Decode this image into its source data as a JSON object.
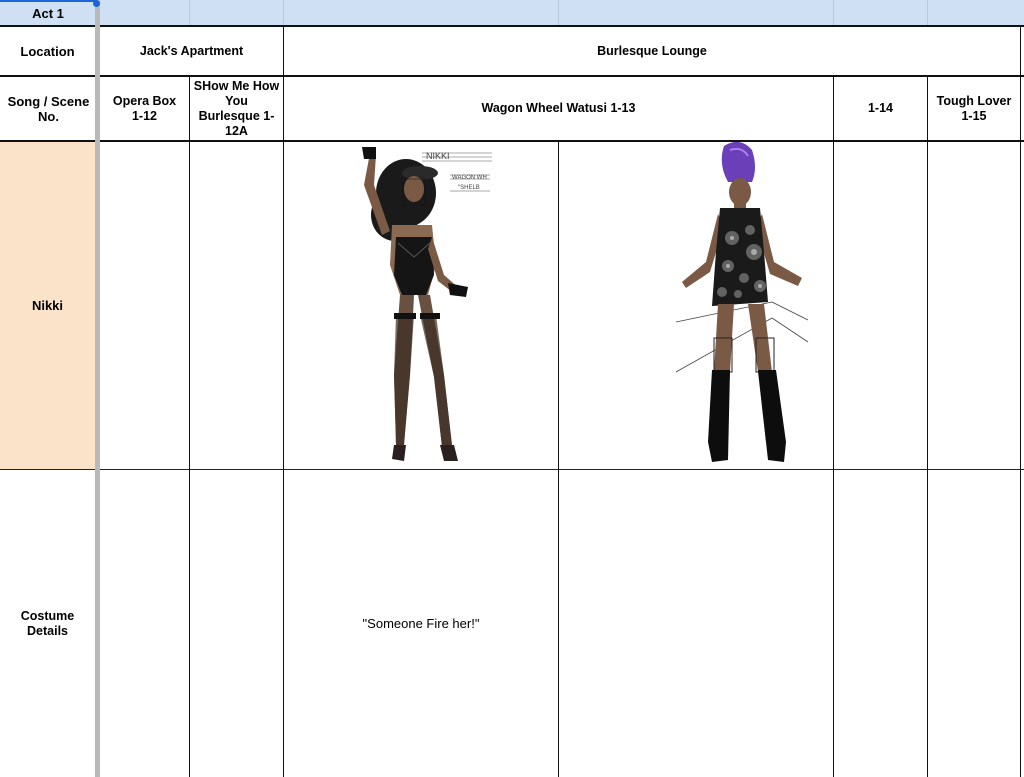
{
  "act": "Act 1",
  "rows": {
    "location_label": "Location",
    "song_label": "Song / Scene No.",
    "character": "Nikki",
    "costume_label": "Costume Details"
  },
  "locations": [
    "Jack's Apartment",
    "Burlesque Lounge"
  ],
  "songs": [
    "Opera Box 1-12",
    "SHow Me How You Burlesque 1-12A",
    "Wagon Wheel Watusi 1-13",
    "1-14",
    "Tough Lover 1-15"
  ],
  "sketch_labels": {
    "name": "NIKKI",
    "line1": "WAGON WH",
    "line2": "\"SHELB"
  },
  "costume_note": "\"Someone Fire her!\"",
  "colors": {
    "header_blue": "#cfe0f4",
    "peach": "#fbe3c9",
    "selection": "#1a66d9"
  },
  "icons": [
    "costume-sketch-fishnet-bodysuit",
    "costume-sketch-sequin-dress-purple-hair"
  ]
}
